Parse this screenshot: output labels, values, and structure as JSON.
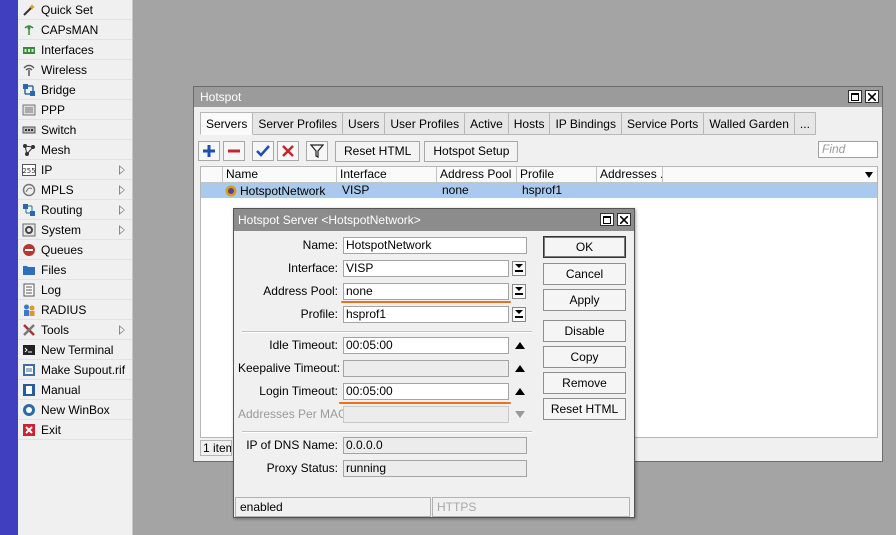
{
  "menu": {
    "items": [
      {
        "label": "Quick Set",
        "icon": "wand-icon"
      },
      {
        "label": "CAPsMAN",
        "icon": "capsman-icon"
      },
      {
        "label": "Interfaces",
        "icon": "interfaces-icon"
      },
      {
        "label": "Wireless",
        "icon": "wireless-icon"
      },
      {
        "label": "Bridge",
        "icon": "bridge-icon"
      },
      {
        "label": "PPP",
        "icon": "ppp-icon"
      },
      {
        "label": "Switch",
        "icon": "switch-icon"
      },
      {
        "label": "Mesh",
        "icon": "mesh-icon"
      },
      {
        "label": "IP",
        "icon": "ip-icon",
        "submenu": true
      },
      {
        "label": "MPLS",
        "icon": "mpls-icon",
        "submenu": true
      },
      {
        "label": "Routing",
        "icon": "routing-icon",
        "submenu": true
      },
      {
        "label": "System",
        "icon": "gear-icon",
        "submenu": true
      },
      {
        "label": "Queues",
        "icon": "queues-icon"
      },
      {
        "label": "Files",
        "icon": "folder-icon"
      },
      {
        "label": "Log",
        "icon": "log-icon"
      },
      {
        "label": "RADIUS",
        "icon": "radius-icon"
      },
      {
        "label": "Tools",
        "icon": "tools-icon",
        "submenu": true
      },
      {
        "label": "New Terminal",
        "icon": "terminal-icon"
      },
      {
        "label": "Make Supout.rif",
        "icon": "supout-icon"
      },
      {
        "label": "Manual",
        "icon": "manual-icon"
      },
      {
        "label": "New WinBox",
        "icon": "winbox-icon"
      },
      {
        "label": "Exit",
        "icon": "exit-icon"
      }
    ]
  },
  "hotspot": {
    "title": "Hotspot",
    "tabs": [
      "Servers",
      "Server Profiles",
      "Users",
      "User Profiles",
      "Active",
      "Hosts",
      "IP Bindings",
      "Service Ports",
      "Walled Garden",
      "..."
    ],
    "active_tab": "Servers",
    "toolbar": {
      "reset_html": "Reset HTML",
      "hotspot_setup": "Hotspot Setup"
    },
    "find_placeholder": "Find",
    "columns": [
      "Name",
      "Interface",
      "Address Pool",
      "Profile",
      "Addresses ..."
    ],
    "rows": [
      {
        "name": "HotspotNetwork",
        "interface": "VISP",
        "address_pool": "none",
        "profile": "hsprof1"
      }
    ],
    "status": "1 item"
  },
  "dialog": {
    "title": "Hotspot Server <HotspotNetwork>",
    "fields": {
      "name": {
        "label": "Name:",
        "value": "HotspotNetwork"
      },
      "interface": {
        "label": "Interface:",
        "value": "VISP"
      },
      "address_pool": {
        "label": "Address Pool:",
        "value": "none"
      },
      "profile": {
        "label": "Profile:",
        "value": "hsprof1"
      },
      "idle_timeout": {
        "label": "Idle Timeout:",
        "value": "00:05:00"
      },
      "keepalive_timeout": {
        "label": "Keepalive Timeout:",
        "value": ""
      },
      "login_timeout": {
        "label": "Login Timeout:",
        "value": "00:05:00"
      },
      "addresses_per_mac": {
        "label": "Addresses Per MAC:",
        "value": ""
      },
      "ip_of_dns_name": {
        "label": "IP of DNS Name:",
        "value": "0.0.0.0"
      },
      "proxy_status": {
        "label": "Proxy Status:",
        "value": "running"
      }
    },
    "buttons": {
      "ok": "OK",
      "cancel": "Cancel",
      "apply": "Apply",
      "disable": "Disable",
      "copy": "Copy",
      "remove": "Remove",
      "reset_html": "Reset HTML"
    },
    "status": {
      "left": "enabled",
      "right": "HTTPS"
    }
  },
  "colors": {
    "accent_strip": "#3f3fbf",
    "selection": "#aac9ec",
    "highlight_underline": "#e8701e"
  }
}
